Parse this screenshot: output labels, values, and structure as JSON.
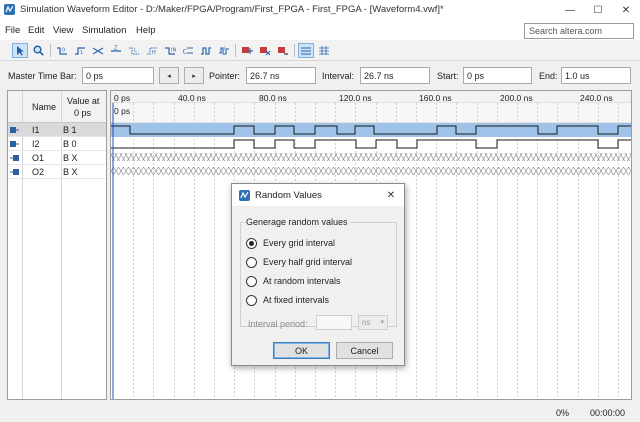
{
  "window": {
    "title": "Simulation Waveform Editor - D:/Maker/FPGA/Program/First_FPGA - First_FPGA - [Waveform4.vwf]*",
    "min_glyph": "—",
    "max_glyph": "☐",
    "close_glyph": "✕"
  },
  "menu": {
    "items": [
      "File",
      "Edit",
      "View",
      "Simulation",
      "Help"
    ],
    "search_placeholder": "Search altera.com"
  },
  "toolbar": {
    "icons": [
      "pointer-tool-icon",
      "zoom-tool-icon",
      "force-low-icon",
      "force-high-icon",
      "force-unknown-icon",
      "force-high-z-icon",
      "weak-low-icon",
      "weak-high-icon",
      "invert-icon",
      "count-value-icon",
      "overwrite-clock-icon",
      "random-values-icon",
      "insert-node-icon",
      "delete-node-icon",
      "node-options-icon",
      "snap-to-grid-icon",
      "grid-size-icon"
    ]
  },
  "timebar": {
    "master_label": "Master Time Bar:",
    "master_value": "0 ps",
    "prev_glyph": "◂",
    "next_glyph": "▸",
    "pointer_label": "Pointer:",
    "pointer_value": "26.7 ns",
    "interval_label": "Interval:",
    "interval_value": "26.7 ns",
    "start_label": "Start:",
    "start_value": "0 ps",
    "end_label": "End:",
    "end_value": "1.0 us"
  },
  "signals": {
    "header_name": "Name",
    "header_value_1": "Value at",
    "header_value_2": "0 ps",
    "rows": [
      {
        "name": "I1",
        "value": "B 1",
        "type": "input",
        "selected": true
      },
      {
        "name": "I2",
        "value": "B 0",
        "type": "input",
        "selected": false
      },
      {
        "name": "O1",
        "value": "B X",
        "type": "output",
        "selected": false
      },
      {
        "name": "O2",
        "value": "B X",
        "type": "output",
        "selected": false
      }
    ]
  },
  "waveform": {
    "ticks": [
      "0 ps",
      "40.0 ns",
      "80.0 ns",
      "120.0 ns",
      "160.0 ns",
      "200.0 ns",
      "240.0 ns"
    ],
    "cursor_label": "0 ps",
    "highlight_color": "#9fc2e9",
    "wave_color": "#1a1a1a"
  },
  "dialog": {
    "title": "Random Values",
    "close_glyph": "✕",
    "group_label": "Generage random values",
    "options": [
      "Every grid interval",
      "Every half grid interval",
      "At random intervals",
      "At fixed intervals"
    ],
    "selected_index": 0,
    "interval_label": "Interval period:",
    "interval_unit": "ns",
    "ok_label": "OK",
    "cancel_label": "Cancel"
  },
  "status": {
    "percent": "0%",
    "time": "00:00:00"
  }
}
